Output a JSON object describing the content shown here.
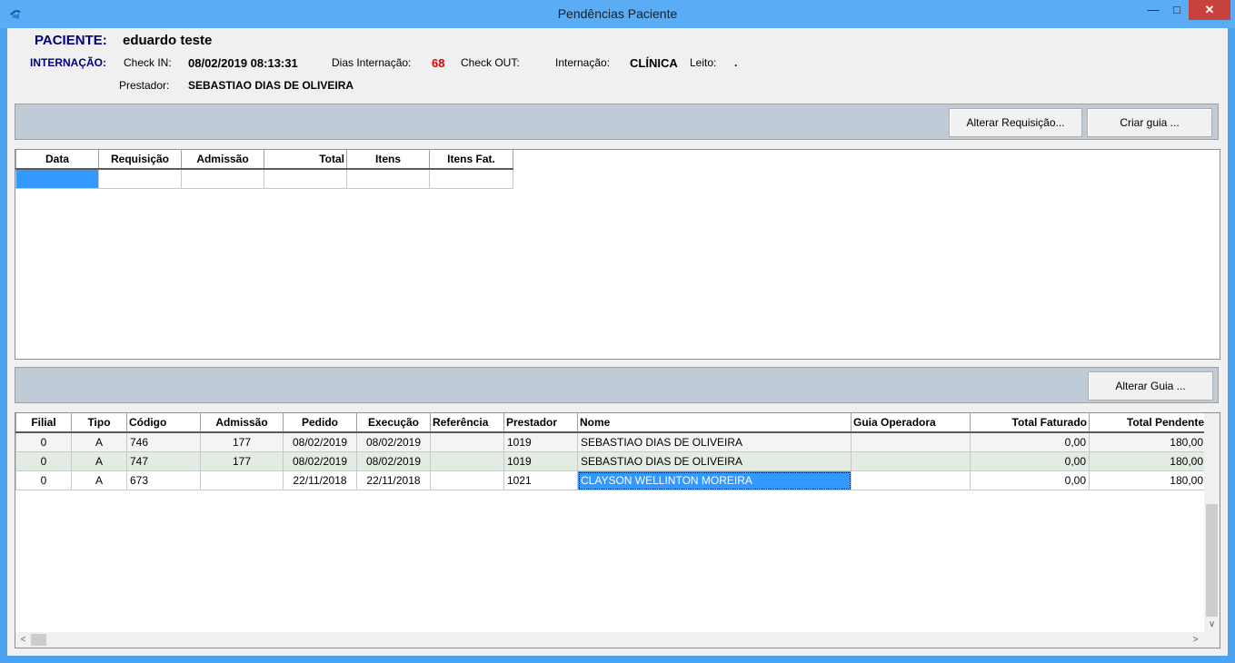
{
  "window": {
    "title": "Pendências Paciente"
  },
  "patient": {
    "label": "PACIENTE:",
    "name": "eduardo teste"
  },
  "admission": {
    "label": "INTERNAÇÃO:",
    "checkin_label": "Check IN:",
    "checkin_value": "08/02/2019 08:13:31",
    "days_label": "Dias Internação:",
    "days_value": "68",
    "checkout_label": "Check OUT:",
    "checkout_value": "",
    "type_label": "Internação:",
    "type_value": "CLÍNICA",
    "bed_label": "Leito:",
    "bed_value": ".",
    "provider_label": "Prestador:",
    "provider_value": "SEBASTIAO DIAS DE OLIVEIRA"
  },
  "toolbar1": {
    "alter_requisition": "Alterar Requisição...",
    "create_guide": "Criar guia ..."
  },
  "requisitions": {
    "columns": [
      "Data",
      "Requisição",
      "Admissão",
      "Total",
      "Itens",
      "Itens Fat."
    ],
    "rows": [
      [
        "",
        "",
        "",
        "",
        "",
        ""
      ]
    ]
  },
  "toolbar2": {
    "alter_guide": "Alterar Guia ..."
  },
  "guides": {
    "columns": [
      "Filial",
      "Tipo",
      "Código",
      "Admissão",
      "Pedido",
      "Execução",
      "Referência",
      "Prestador",
      "Nome",
      "Guia Operadora",
      "Total Faturado",
      "Total Pendente"
    ],
    "rows": [
      [
        "0",
        "A",
        "746",
        "177",
        "08/02/2019",
        "08/02/2019",
        "",
        "1019",
        "SEBASTIAO DIAS DE OLIVEIRA",
        "",
        "0,00",
        "180,00"
      ],
      [
        "0",
        "A",
        "747",
        "177",
        "08/02/2019",
        "08/02/2019",
        "",
        "1019",
        "SEBASTIAO DIAS DE OLIVEIRA",
        "",
        "0,00",
        "180,00"
      ],
      [
        "0",
        "A",
        "673",
        "",
        "22/11/2018",
        "22/11/2018",
        "",
        "1021",
        "CLAYSON WELLINTON MOREIRA",
        "",
        "0,00",
        "180,00"
      ]
    ]
  },
  "colors": {
    "title_bar": "#5aacf4",
    "panel": "#bfccd8",
    "selection": "#3399ff",
    "label_navy": "#000080",
    "days_red": "#e00000"
  }
}
